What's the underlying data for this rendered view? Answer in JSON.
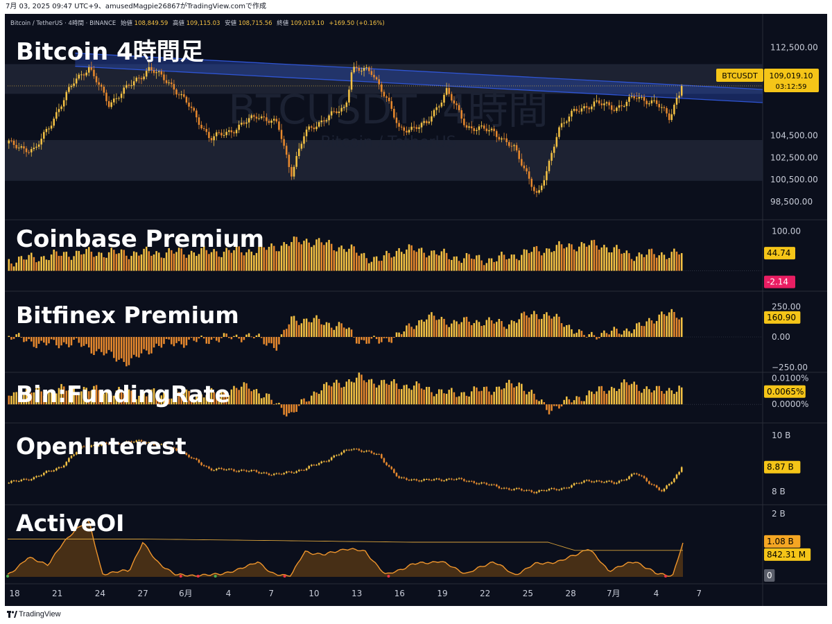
{
  "header": {
    "text": "7月 03, 2025 09:47 UTC+9、amusedMagpie26867がTradingView.comで作成"
  },
  "footer": {
    "brand": "TradingView",
    "logo_icon": "tradingview-logo-icon"
  },
  "colors": {
    "background": "#0b0f1c",
    "up": "#f5c244",
    "down": "#e8892d",
    "channel": "#2f55d4",
    "zone": "#1f2535",
    "axis_text": "#c8ccd8",
    "label_bg": "#f5c518",
    "negative_label": "#e91e63",
    "gray_label": "#5b5f6b"
  },
  "main": {
    "info_line": {
      "symbol": "Bitcoin / TetherUS · 4時間 · BINANCE",
      "open_label": "始値",
      "open": "108,849.59",
      "high_label": "高値",
      "high": "109,115.03",
      "low_label": "安値",
      "low": "108,715.56",
      "close_label": "終値",
      "close": "109,019.10",
      "change": "+169.50 (+0.16%)"
    },
    "watermark": "BTCUSDT, 4時間",
    "watermark_sub": "Bitcoin / TetherUS",
    "symbol_label": "BTCUSDT",
    "price_label": "109,019.10",
    "countdown": "03:12:59"
  },
  "chart_data": [
    {
      "type": "candlestick",
      "title": "Bitcoin 4時間足",
      "y_ticks": [
        "112,500.00",
        "104,500.00",
        "102,500.00",
        "100,500.00",
        "98,500.00"
      ],
      "y_tick_values": [
        112500,
        104500,
        102500,
        100500,
        98500
      ],
      "ylim": [
        97300,
        113800
      ],
      "last_value": 109019.1,
      "trend_channel": {
        "start": {
          "x": 0.1,
          "y": 112000
        },
        "end": {
          "x": 1.0,
          "y": 108700
        },
        "width": 1200
      },
      "resistance_zone": [
        108300,
        111000
      ],
      "support_zone": [
        100400,
        104100
      ],
      "x_ticks": [
        "18",
        "21",
        "24",
        "27",
        "6月",
        "4",
        "7",
        "10",
        "13",
        "16",
        "19",
        "22",
        "25",
        "28",
        "7月",
        "4",
        "7"
      ],
      "anchors": [
        {
          "x": 0.0,
          "y": 103800
        },
        {
          "x": 0.04,
          "y": 103100
        },
        {
          "x": 0.07,
          "y": 106300
        },
        {
          "x": 0.1,
          "y": 109600
        },
        {
          "x": 0.12,
          "y": 110700
        },
        {
          "x": 0.15,
          "y": 107400
        },
        {
          "x": 0.18,
          "y": 109000
        },
        {
          "x": 0.21,
          "y": 110600
        },
        {
          "x": 0.24,
          "y": 109300
        },
        {
          "x": 0.27,
          "y": 107100
        },
        {
          "x": 0.3,
          "y": 104200
        },
        {
          "x": 0.34,
          "y": 105200
        },
        {
          "x": 0.37,
          "y": 106400
        },
        {
          "x": 0.4,
          "y": 105500
        },
        {
          "x": 0.42,
          "y": 101100
        },
        {
          "x": 0.44,
          "y": 104700
        },
        {
          "x": 0.47,
          "y": 106100
        },
        {
          "x": 0.5,
          "y": 107000
        },
        {
          "x": 0.51,
          "y": 110700
        },
        {
          "x": 0.54,
          "y": 110200
        },
        {
          "x": 0.56,
          "y": 108100
        },
        {
          "x": 0.58,
          "y": 105000
        },
        {
          "x": 0.62,
          "y": 105500
        },
        {
          "x": 0.65,
          "y": 108600
        },
        {
          "x": 0.68,
          "y": 105300
        },
        {
          "x": 0.72,
          "y": 104900
        },
        {
          "x": 0.75,
          "y": 103300
        },
        {
          "x": 0.77,
          "y": 101000
        },
        {
          "x": 0.785,
          "y": 98900
        },
        {
          "x": 0.8,
          "y": 101500
        },
        {
          "x": 0.815,
          "y": 105200
        },
        {
          "x": 0.84,
          "y": 106700
        },
        {
          "x": 0.87,
          "y": 107500
        },
        {
          "x": 0.9,
          "y": 107000
        },
        {
          "x": 0.93,
          "y": 108000
        },
        {
          "x": 0.96,
          "y": 107500
        },
        {
          "x": 0.98,
          "y": 106100
        },
        {
          "x": 0.99,
          "y": 107800
        },
        {
          "x": 1.0,
          "y": 109000
        }
      ]
    },
    {
      "type": "bar",
      "title": "Coinbase Premium",
      "y_ticks": [
        "100.00"
      ],
      "y_tick_values": [
        100
      ],
      "ylim": [
        -20,
        115
      ],
      "last_value": 44.74,
      "last_label": "44.74",
      "secondary_label": "-2.14",
      "anchors": [
        {
          "x": 0.0,
          "y": 25
        },
        {
          "x": 0.1,
          "y": 45
        },
        {
          "x": 0.2,
          "y": 45
        },
        {
          "x": 0.3,
          "y": 48
        },
        {
          "x": 0.37,
          "y": 52
        },
        {
          "x": 0.44,
          "y": 78
        },
        {
          "x": 0.5,
          "y": 58
        },
        {
          "x": 0.55,
          "y": 25
        },
        {
          "x": 0.58,
          "y": 55
        },
        {
          "x": 0.62,
          "y": 50
        },
        {
          "x": 0.66,
          "y": 35
        },
        {
          "x": 0.72,
          "y": 28
        },
        {
          "x": 0.78,
          "y": 50
        },
        {
          "x": 0.84,
          "y": 65
        },
        {
          "x": 0.88,
          "y": 65
        },
        {
          "x": 0.92,
          "y": 40
        },
        {
          "x": 0.96,
          "y": 42
        },
        {
          "x": 1.0,
          "y": 45
        }
      ]
    },
    {
      "type": "bar",
      "title": "Bitfinex Premium",
      "y_ticks": [
        "250.00",
        "0.00",
        "−250.00"
      ],
      "y_tick_values": [
        250,
        0,
        -250
      ],
      "ylim": [
        -280,
        320
      ],
      "last_value": 160.9,
      "last_label": "160.90",
      "anchors": [
        {
          "x": 0.0,
          "y": 10
        },
        {
          "x": 0.05,
          "y": -60
        },
        {
          "x": 0.1,
          "y": -50
        },
        {
          "x": 0.15,
          "y": -150
        },
        {
          "x": 0.18,
          "y": -210
        },
        {
          "x": 0.22,
          "y": -70
        },
        {
          "x": 0.3,
          "y": -20
        },
        {
          "x": 0.36,
          "y": 10
        },
        {
          "x": 0.4,
          "y": -80
        },
        {
          "x": 0.42,
          "y": 150
        },
        {
          "x": 0.46,
          "y": 130
        },
        {
          "x": 0.5,
          "y": 80
        },
        {
          "x": 0.52,
          "y": -30
        },
        {
          "x": 0.55,
          "y": -40
        },
        {
          "x": 0.58,
          "y": 20
        },
        {
          "x": 0.62,
          "y": 170
        },
        {
          "x": 0.66,
          "y": 120
        },
        {
          "x": 0.7,
          "y": 130
        },
        {
          "x": 0.74,
          "y": 110
        },
        {
          "x": 0.78,
          "y": 200
        },
        {
          "x": 0.82,
          "y": 140
        },
        {
          "x": 0.85,
          "y": 10
        },
        {
          "x": 0.9,
          "y": 40
        },
        {
          "x": 0.94,
          "y": 90
        },
        {
          "x": 0.97,
          "y": 200
        },
        {
          "x": 1.0,
          "y": 160
        }
      ]
    },
    {
      "type": "bar",
      "title": "Bin:FundingRate",
      "y_ticks": [
        "0.0100%",
        "0.0000%"
      ],
      "y_tick_values": [
        0.01,
        0
      ],
      "ylim": [
        -0.005,
        0.0115
      ],
      "last_value": 0.0065,
      "last_label": "0.0065%",
      "anchors": [
        {
          "x": 0.0,
          "y": 0.004
        },
        {
          "x": 0.1,
          "y": 0.006
        },
        {
          "x": 0.2,
          "y": 0.004
        },
        {
          "x": 0.3,
          "y": 0.004
        },
        {
          "x": 0.36,
          "y": 0.007
        },
        {
          "x": 0.42,
          "y": -0.004
        },
        {
          "x": 0.46,
          "y": 0.006
        },
        {
          "x": 0.52,
          "y": 0.01
        },
        {
          "x": 0.56,
          "y": 0.008
        },
        {
          "x": 0.6,
          "y": 0.007
        },
        {
          "x": 0.66,
          "y": 0.004
        },
        {
          "x": 0.72,
          "y": 0.006
        },
        {
          "x": 0.76,
          "y": 0.008
        },
        {
          "x": 0.8,
          "y": -0.002
        },
        {
          "x": 0.86,
          "y": 0.004
        },
        {
          "x": 0.92,
          "y": 0.008
        },
        {
          "x": 0.96,
          "y": 0.005
        },
        {
          "x": 1.0,
          "y": 0.0065
        }
      ]
    },
    {
      "type": "candlestick",
      "title": "OpenInterest",
      "y_ticks": [
        "10 B",
        "8 B"
      ],
      "y_tick_values": [
        10,
        8
      ],
      "ylim": [
        7.6,
        10.25
      ],
      "last_value": 8.87,
      "last_label": "8.87 B",
      "anchors": [
        {
          "x": 0.0,
          "y": 8.3
        },
        {
          "x": 0.04,
          "y": 8.5
        },
        {
          "x": 0.08,
          "y": 8.9
        },
        {
          "x": 0.11,
          "y": 9.6
        },
        {
          "x": 0.15,
          "y": 9.7
        },
        {
          "x": 0.2,
          "y": 9.8
        },
        {
          "x": 0.25,
          "y": 9.5
        },
        {
          "x": 0.3,
          "y": 8.8
        },
        {
          "x": 0.35,
          "y": 8.75
        },
        {
          "x": 0.4,
          "y": 8.6
        },
        {
          "x": 0.44,
          "y": 8.8
        },
        {
          "x": 0.47,
          "y": 9.1
        },
        {
          "x": 0.51,
          "y": 9.55
        },
        {
          "x": 0.55,
          "y": 9.3
        },
        {
          "x": 0.58,
          "y": 8.45
        },
        {
          "x": 0.62,
          "y": 8.4
        },
        {
          "x": 0.66,
          "y": 8.45
        },
        {
          "x": 0.7,
          "y": 8.3
        },
        {
          "x": 0.74,
          "y": 8.1
        },
        {
          "x": 0.78,
          "y": 8.0
        },
        {
          "x": 0.82,
          "y": 8.1
        },
        {
          "x": 0.86,
          "y": 8.4
        },
        {
          "x": 0.9,
          "y": 8.3
        },
        {
          "x": 0.93,
          "y": 8.65
        },
        {
          "x": 0.97,
          "y": 8.0
        },
        {
          "x": 0.985,
          "y": 8.4
        },
        {
          "x": 1.0,
          "y": 8.87
        }
      ]
    },
    {
      "type": "area",
      "title": "ActiveOI",
      "y_ticks": [
        "2 B"
      ],
      "y_tick_values": [
        2
      ],
      "ylim": [
        0,
        2.2
      ],
      "last_value": 1.08,
      "last_label": "1.08 B",
      "average_label": "842.31 M",
      "zero_label": "0",
      "anchors": [
        {
          "x": 0.0,
          "y": 0.05
        },
        {
          "x": 0.03,
          "y": 0.6
        },
        {
          "x": 0.06,
          "y": 0.4
        },
        {
          "x": 0.08,
          "y": 1.0
        },
        {
          "x": 0.1,
          "y": 1.5
        },
        {
          "x": 0.12,
          "y": 1.8
        },
        {
          "x": 0.14,
          "y": 0.1
        },
        {
          "x": 0.18,
          "y": 0.2
        },
        {
          "x": 0.2,
          "y": 1.1
        },
        {
          "x": 0.22,
          "y": 0.5
        },
        {
          "x": 0.25,
          "y": 0.05
        },
        {
          "x": 0.3,
          "y": 0.05
        },
        {
          "x": 0.34,
          "y": 0.2
        },
        {
          "x": 0.37,
          "y": 0.5
        },
        {
          "x": 0.39,
          "y": 0.1
        },
        {
          "x": 0.42,
          "y": 0.05
        },
        {
          "x": 0.44,
          "y": 0.8
        },
        {
          "x": 0.47,
          "y": 0.7
        },
        {
          "x": 0.5,
          "y": 0.9
        },
        {
          "x": 0.53,
          "y": 0.8
        },
        {
          "x": 0.56,
          "y": 0.05
        },
        {
          "x": 0.6,
          "y": 0.4
        },
        {
          "x": 0.64,
          "y": 0.5
        },
        {
          "x": 0.68,
          "y": 0.1
        },
        {
          "x": 0.72,
          "y": 0.5
        },
        {
          "x": 0.75,
          "y": 0.05
        },
        {
          "x": 0.78,
          "y": 0.4
        },
        {
          "x": 0.82,
          "y": 0.5
        },
        {
          "x": 0.86,
          "y": 0.9
        },
        {
          "x": 0.89,
          "y": 0.2
        },
        {
          "x": 0.93,
          "y": 0.5
        },
        {
          "x": 0.96,
          "y": 0.1
        },
        {
          "x": 0.985,
          "y": 0.05
        },
        {
          "x": 1.0,
          "y": 1.08
        }
      ],
      "average_anchors": [
        {
          "x": 0.0,
          "y": 1.2
        },
        {
          "x": 0.2,
          "y": 1.2
        },
        {
          "x": 0.4,
          "y": 1.15
        },
        {
          "x": 0.6,
          "y": 1.1
        },
        {
          "x": 0.8,
          "y": 1.1
        },
        {
          "x": 0.84,
          "y": 0.84
        },
        {
          "x": 1.0,
          "y": 0.84
        }
      ]
    }
  ]
}
